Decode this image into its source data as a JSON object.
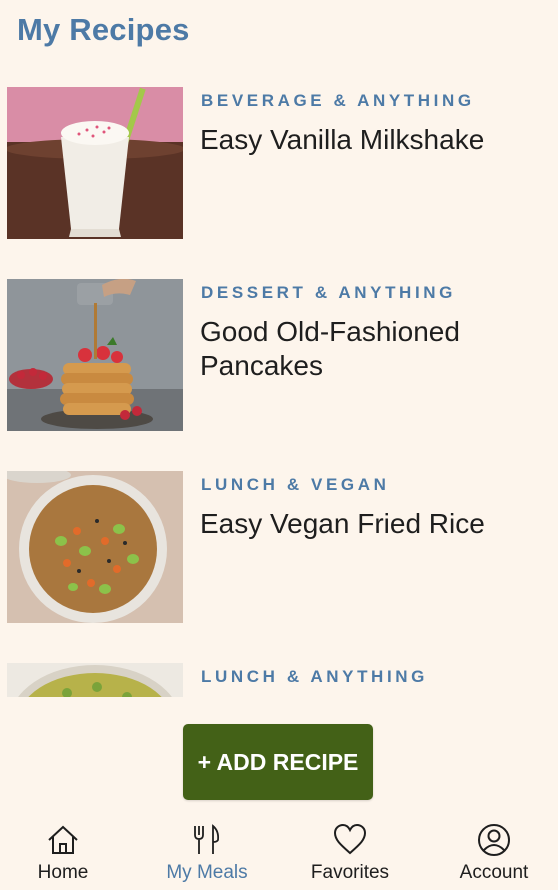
{
  "page": {
    "title": "My Recipes"
  },
  "recipes": [
    {
      "category": "BEVERAGE & ANYTHING",
      "title": "Easy Vanilla Milkshake",
      "image": "milkshake-photo"
    },
    {
      "category": "DESSERT & ANYTHING",
      "title": "Good Old-Fashioned Pancakes",
      "image": "pancakes-photo"
    },
    {
      "category": "LUNCH & VEGAN",
      "title": "Easy Vegan Fried Rice",
      "image": "fried-rice-photo"
    },
    {
      "category": "LUNCH & ANYTHING",
      "title": "",
      "image": "salad-photo"
    }
  ],
  "add_button": {
    "label": "+ ADD RECIPE"
  },
  "nav": {
    "items": [
      {
        "label": "Home",
        "icon": "home-icon"
      },
      {
        "label": "My Meals",
        "icon": "fork-knife-icon"
      },
      {
        "label": "Favorites",
        "icon": "heart-icon"
      },
      {
        "label": "Account",
        "icon": "account-icon"
      }
    ],
    "active_index": 1
  },
  "colors": {
    "accent": "#4d7aa6",
    "button": "#436117",
    "background": "#fdf5ec",
    "text": "#1e1e1e"
  }
}
